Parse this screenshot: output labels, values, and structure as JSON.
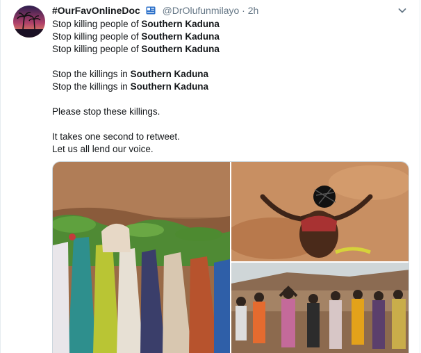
{
  "tweet": {
    "display_name": "#OurFavOnlineDoc",
    "handle": "@DrOlufunmilayo",
    "separator": "·",
    "time": "2h",
    "lines": [
      {
        "plain": "Stop killing people of ",
        "bold": "Southern Kaduna"
      },
      {
        "plain": "Stop killing people of ",
        "bold": "Southern Kaduna"
      },
      {
        "plain": "Stop killing people of ",
        "bold": "Southern Kaduna"
      },
      {
        "plain": "Stop the killings in ",
        "bold": "Southern Kaduna"
      },
      {
        "plain": "Stop the killings in ",
        "bold": "Southern Kaduna"
      },
      {
        "plain": "Please stop these killings.",
        "bold": ""
      },
      {
        "plain": "It takes one second to retweet.",
        "bold": ""
      },
      {
        "plain": "Let us all lend our voice.",
        "bold": ""
      }
    ]
  },
  "icons": {
    "verified": "id-card-icon",
    "menu": "chevron-down-icon"
  },
  "colors": {
    "text": "#14171a",
    "secondary": "#657786",
    "border": "#e6ecf0",
    "badge": "#2a6fc9"
  }
}
